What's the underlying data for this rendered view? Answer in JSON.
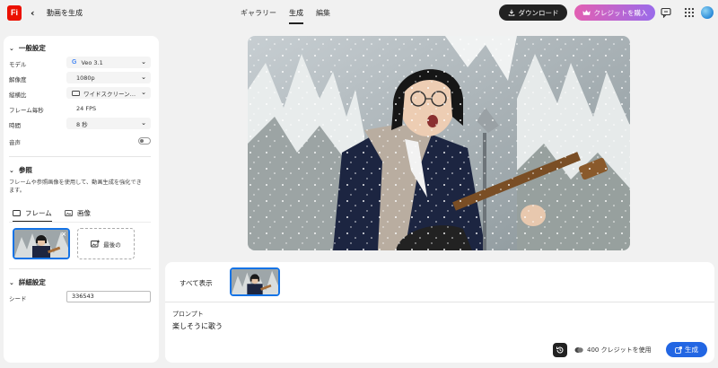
{
  "header": {
    "logo_text": "Fi",
    "title": "動画を生成",
    "tabs": [
      {
        "label": "ギャラリー",
        "active": false
      },
      {
        "label": "生成",
        "active": true
      },
      {
        "label": "編集",
        "active": false
      }
    ],
    "download_label": "ダウンロード",
    "buy_credits_label": "クレジットを購入"
  },
  "left_panel": {
    "general": {
      "heading": "一般設定",
      "model_label": "モデル",
      "model_value": "Veo 3.1",
      "resolution_label": "解像度",
      "resolution_value": "1080p",
      "aspect_label": "縦横比",
      "aspect_value": "ワイドスクリーン…",
      "fps_label": "フレーム毎秒",
      "fps_value": "24 FPS",
      "duration_label": "時間",
      "duration_value": "8 秒",
      "audio_label": "音声",
      "audio_on": false
    },
    "reference": {
      "heading": "参照",
      "description": "フレームや参照画像を使用して、動画生成を強化できます。",
      "tab_frame": "フレーム",
      "tab_image": "画像",
      "last_frame_label": "最後の"
    },
    "advanced": {
      "heading": "詳細設定",
      "seed_label": "シード",
      "seed_value": "336543"
    }
  },
  "bottom_panel": {
    "show_all": "すべて表示",
    "prompt_label": "プロンプト",
    "prompt_text": "楽しそうに歌う",
    "credit_usage": "400 クレジットを使用",
    "generate_label": "生成"
  },
  "colors": {
    "accent_blue": "#1473e6",
    "generate_blue": "#2266e3",
    "logo_red": "#eb1000",
    "credit_gradient_start": "#e25fb2",
    "credit_gradient_end": "#9a6bea"
  }
}
